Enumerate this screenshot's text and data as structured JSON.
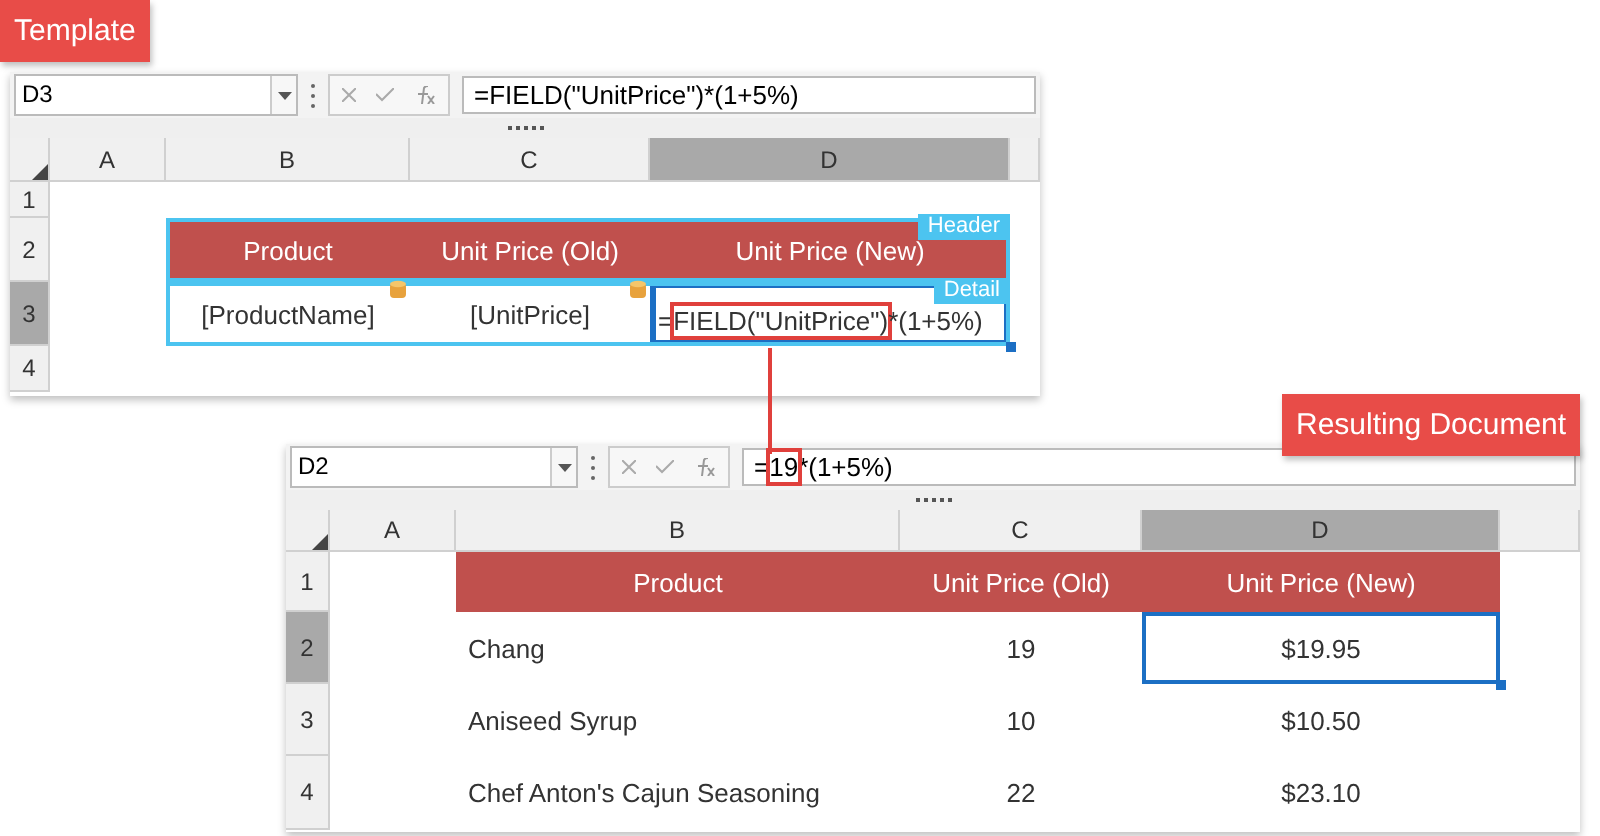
{
  "template_label": "Template",
  "result_label": "Resulting Document",
  "template_sheet": {
    "name_box": "D3",
    "formula": [
      {
        "text": "=FIELD(\"UnitPrice\")*(1+5%)",
        "highlighted": false
      }
    ],
    "columns": [
      {
        "label": "A",
        "selected": false
      },
      {
        "label": "B",
        "selected": false
      },
      {
        "label": "C",
        "selected": false
      },
      {
        "label": "D",
        "selected": true
      }
    ],
    "rows": [
      {
        "label": "1",
        "selected": false
      },
      {
        "label": "2",
        "selected": false,
        "range_tag": "Header",
        "cells": [
          {
            "kind": "empty",
            "text": ""
          },
          {
            "kind": "header",
            "text": "Product"
          },
          {
            "kind": "header",
            "text": "Unit Price (Old)"
          },
          {
            "kind": "header",
            "text": "Unit Price (New)"
          }
        ]
      },
      {
        "label": "3",
        "selected": true,
        "range_tag": "Detail",
        "cells": [
          {
            "kind": "empty",
            "text": ""
          },
          {
            "kind": "field",
            "text": "[ProductName]"
          },
          {
            "kind": "field",
            "text": "[UnitPrice]"
          },
          {
            "kind": "formula",
            "active": true,
            "segments": [
              {
                "text": "=",
                "highlighted": false
              },
              {
                "text": "FIELD(\"UnitPrice\")",
                "highlighted": true
              },
              {
                "text": "*(1+5%)",
                "highlighted": false
              }
            ]
          }
        ]
      },
      {
        "label": "4",
        "selected": false
      }
    ]
  },
  "result_sheet": {
    "name_box": "D2",
    "formula": [
      {
        "text": "=",
        "highlighted": false
      },
      {
        "text": "19",
        "highlighted": true
      },
      {
        "text": "*(1+5%)",
        "highlighted": false
      }
    ],
    "columns": [
      {
        "label": "A",
        "selected": false
      },
      {
        "label": "B",
        "selected": false
      },
      {
        "label": "C",
        "selected": false
      },
      {
        "label": "D",
        "selected": true
      }
    ],
    "rows": [
      {
        "label": "1",
        "selected": false,
        "cells": [
          {
            "kind": "empty",
            "text": ""
          },
          {
            "kind": "header",
            "text": "Product"
          },
          {
            "kind": "header",
            "text": "Unit Price (Old)"
          },
          {
            "kind": "header",
            "text": "Unit Price (New)"
          }
        ]
      },
      {
        "label": "2",
        "selected": true,
        "cells": [
          {
            "kind": "empty",
            "text": ""
          },
          {
            "kind": "text",
            "text": "Chang"
          },
          {
            "kind": "number",
            "text": "19"
          },
          {
            "kind": "number",
            "text": "$19.95",
            "active": true
          }
        ]
      },
      {
        "label": "3",
        "selected": false,
        "cells": [
          {
            "kind": "empty",
            "text": ""
          },
          {
            "kind": "text",
            "text": "Aniseed Syrup"
          },
          {
            "kind": "number",
            "text": "10"
          },
          {
            "kind": "number",
            "text": "$10.50"
          }
        ]
      },
      {
        "label": "4",
        "selected": false,
        "cells": [
          {
            "kind": "empty",
            "text": ""
          },
          {
            "kind": "text",
            "text": "Chef Anton's Cajun Seasoning"
          },
          {
            "kind": "number",
            "text": "22"
          },
          {
            "kind": "number",
            "text": "$23.10"
          }
        ]
      }
    ]
  }
}
